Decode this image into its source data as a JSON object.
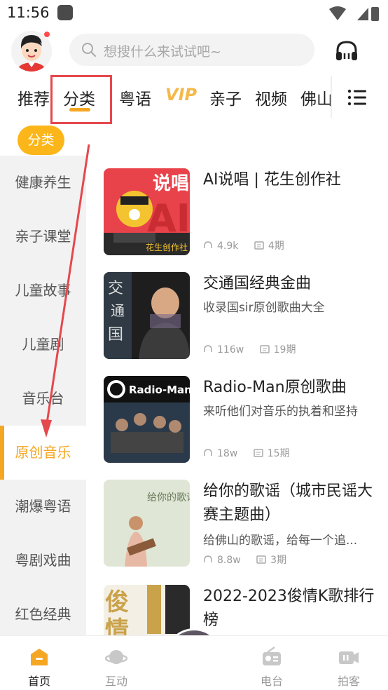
{
  "status_bar": {
    "time": "11:56"
  },
  "search": {
    "placeholder": "想搜什么来试试吧~"
  },
  "tabs": [
    {
      "label": "推荐"
    },
    {
      "label": "分类"
    },
    {
      "label": "粤语"
    },
    {
      "label": "VIP"
    },
    {
      "label": "亲子"
    },
    {
      "label": "视频"
    },
    {
      "label": "佛山"
    }
  ],
  "category_pill": "分类",
  "sidebar": {
    "items": [
      {
        "label": "健康养生"
      },
      {
        "label": "亲子课堂"
      },
      {
        "label": "儿童故事"
      },
      {
        "label": "儿童剧"
      },
      {
        "label": "音乐台"
      },
      {
        "label": "原创音乐"
      },
      {
        "label": "潮爆粤语"
      },
      {
        "label": "粤剧戏曲"
      },
      {
        "label": "红色经典"
      }
    ],
    "active": "原创音乐"
  },
  "list": [
    {
      "title": "AI说唱 | 花生创作社",
      "desc": "",
      "plays": "4.9k",
      "episodes": "4期",
      "cover_text": "说唱"
    },
    {
      "title": "交通国经典金曲",
      "desc": "收录国sir原创歌曲大全",
      "plays": "116w",
      "episodes": "19期",
      "cover_text": ""
    },
    {
      "title": "Radio-Man原创歌曲",
      "desc": "来听他们对音乐的执着和坚持",
      "plays": "18w",
      "episodes": "15期",
      "cover_text": "Radio-Man"
    },
    {
      "title": "给你的歌谣（城市民谣大赛主题曲）",
      "desc": "给佛山的歌谣，给每一个追...",
      "plays": "8.8w",
      "episodes": "3期",
      "cover_text": "给你的歌谣"
    },
    {
      "title": "2022-2023俊情K歌排行榜",
      "desc": "",
      "plays": "",
      "episodes": "",
      "cover_text": ""
    }
  ],
  "bottom_nav": [
    {
      "label": "首页",
      "icon": "home-icon",
      "active": true
    },
    {
      "label": "互动",
      "icon": "planet-icon",
      "active": false
    },
    {
      "label": "电台",
      "icon": "radio-icon",
      "active": false
    },
    {
      "label": "拍客",
      "icon": "video-camera-icon",
      "active": false
    }
  ],
  "colors": {
    "accent": "#f5a623",
    "pill": "#fcb61a",
    "annotation": "#e5484d"
  }
}
